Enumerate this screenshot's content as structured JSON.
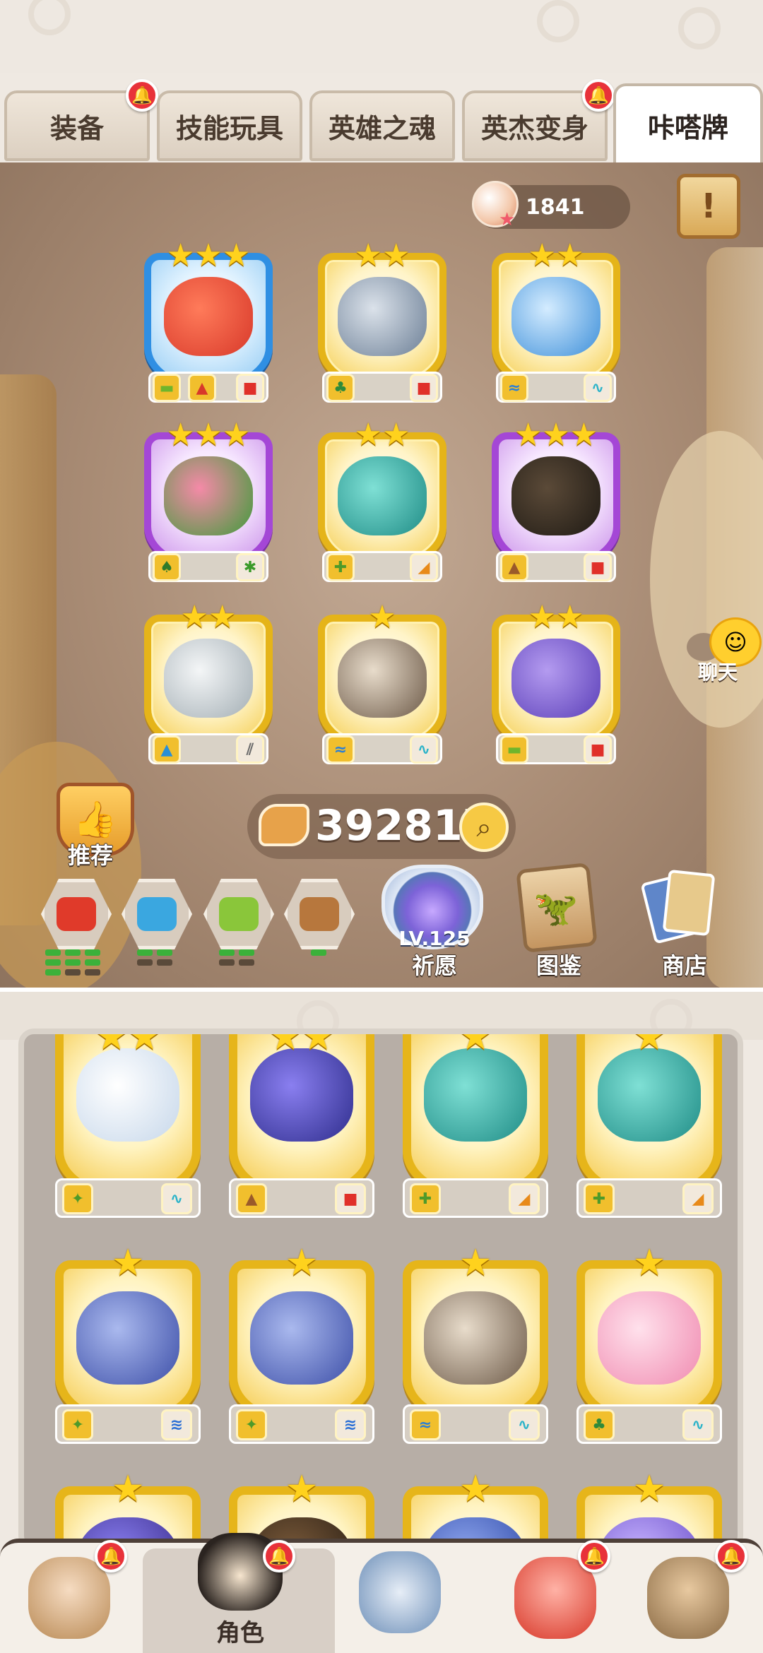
{
  "tabs": [
    {
      "label": "装备",
      "has_alert": true
    },
    {
      "label": "技能玩具",
      "has_alert": false
    },
    {
      "label": "英雄之魂",
      "has_alert": false
    },
    {
      "label": "英杰变身",
      "has_alert": true
    },
    {
      "label": "咔嗒牌",
      "has_alert": false,
      "active": true
    }
  ],
  "header": {
    "shell_count": "1841",
    "shell_icon": "pearl-shell-icon",
    "scroll_icon": "scroll-quest-icon"
  },
  "deck": {
    "cards": [
      {
        "stars": "★★★",
        "rarity": "blue",
        "creature": "red-dragon",
        "elements": [
          "grass",
          "mountain",
          "fire"
        ]
      },
      {
        "stars": "★★",
        "rarity": "gold",
        "creature": "grey-shark-dino",
        "elements": [
          "forest",
          "fire"
        ]
      },
      {
        "stars": "★★",
        "rarity": "gold",
        "creature": "water-wyvern",
        "elements": [
          "water",
          "wind"
        ]
      },
      {
        "stars": "★★★",
        "rarity": "purple",
        "creature": "plant-monster",
        "elements": [
          "jungle",
          "leaf"
        ]
      },
      {
        "stars": "★★",
        "rarity": "gold",
        "creature": "teal-dragon",
        "elements": [
          "cactus",
          "claw"
        ]
      },
      {
        "stars": "★★★",
        "rarity": "purple",
        "creature": "dark-lava-dragon",
        "elements": [
          "mountain",
          "fire"
        ]
      },
      {
        "stars": "★★",
        "rarity": "gold",
        "creature": "white-tiger",
        "elements": [
          "mountain",
          "slash"
        ]
      },
      {
        "stars": "★",
        "rarity": "gold",
        "creature": "pterosaur",
        "elements": [
          "water",
          "wind"
        ]
      },
      {
        "stars": "★★",
        "rarity": "gold",
        "creature": "purple-raptor",
        "elements": [
          "grass",
          "fire"
        ]
      }
    ]
  },
  "bones": {
    "value": "392817",
    "icon": "bone-icon",
    "search_icon": "magnifier-icon"
  },
  "recommend": {
    "label": "推荐",
    "icon": "thumbs-up-medal-icon"
  },
  "chat": {
    "label": "聊天",
    "icon": "chat-emoji-icon"
  },
  "filters": [
    {
      "name": "fire",
      "color": "#e03a2a",
      "bars": [
        true,
        true,
        true,
        false,
        false,
        false
      ]
    },
    {
      "name": "water",
      "color": "#3aa7e0",
      "bars": [
        true,
        true,
        false,
        false
      ]
    },
    {
      "name": "grass",
      "color": "#8ac63a",
      "bars": [
        true,
        true,
        false,
        false
      ]
    },
    {
      "name": "mountain",
      "color": "#b7773d",
      "bars": [
        true
      ]
    }
  ],
  "pray": {
    "level": "LV.125",
    "label": "祈愿",
    "icon": "crystal-orb-icon"
  },
  "dex": {
    "label": "图鉴",
    "icon": "dino-scroll-icon"
  },
  "shop": {
    "label": "商店",
    "icon": "cards-hand-icon"
  },
  "inventory": {
    "rows": [
      [
        {
          "stars": "★★",
          "creature": "white-bird",
          "color": "#e8eef5",
          "elements": [
            "turtle",
            "wind"
          ]
        },
        {
          "stars": "★★",
          "creature": "blue-horn-dragon",
          "color": "#5f6fd6",
          "elements": [
            "mountain",
            "fire"
          ]
        },
        {
          "stars": "★",
          "creature": "teal-dragon",
          "color": "#2aa19a",
          "elements": [
            "cactus",
            "claw"
          ]
        },
        {
          "stars": "★",
          "creature": "teal-dragon",
          "color": "#2aa19a",
          "elements": [
            "cactus",
            "claw"
          ]
        }
      ],
      [
        {
          "stars": "★",
          "creature": "blue-werewolf",
          "color": "#5b6fc9",
          "elements": [
            "turtle",
            "wave"
          ]
        },
        {
          "stars": "★",
          "creature": "blue-werewolf",
          "color": "#5b6fc9",
          "elements": [
            "turtle",
            "wave"
          ]
        },
        {
          "stars": "★",
          "creature": "pterosaur",
          "color": "#8a7a66",
          "elements": [
            "water",
            "wind"
          ]
        },
        {
          "stars": "★",
          "creature": "pink-bird",
          "color": "#f3b0c8",
          "elements": [
            "forest",
            "wind"
          ]
        }
      ],
      [
        {
          "stars": "★",
          "creature": "purple-dragon",
          "color": "#5a4fb8"
        },
        {
          "stars": "★",
          "creature": "spiky-dragon",
          "color": "#4b3a2a"
        },
        {
          "stars": "★",
          "creature": "blue-beast",
          "color": "#4b66c9"
        },
        {
          "stars": "★",
          "creature": "purple-dino",
          "color": "#8b6fd6"
        }
      ]
    ]
  },
  "nav": {
    "items": [
      {
        "icon": "caveman-icon",
        "has_alert": true
      },
      {
        "icon": "hero-portrait-icon",
        "label": "角色",
        "has_alert": true,
        "active": true
      },
      {
        "icon": "sword-shield-icon",
        "has_alert": false
      },
      {
        "icon": "red-dino-icon",
        "has_alert": true
      },
      {
        "icon": "tiki-mask-icon",
        "has_alert": true
      }
    ]
  },
  "colors": {
    "gold_frame": "#e5b419",
    "purple_frame": "#a447d6",
    "blue_frame": "#2f8fe3",
    "alert_red": "#e8323a",
    "star": "#ffd21d"
  }
}
